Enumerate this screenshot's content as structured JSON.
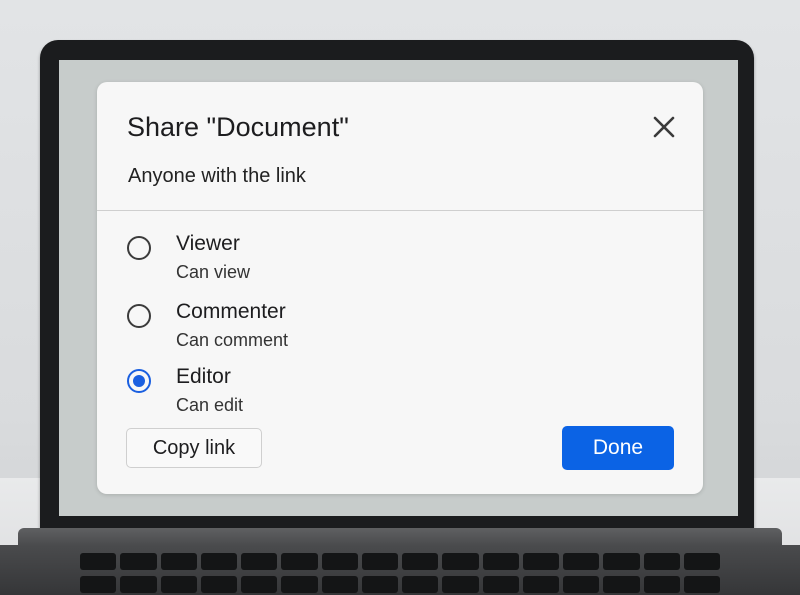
{
  "dialog": {
    "title": "Share \"Document\"",
    "subtitle": "Anyone with the link",
    "close_icon": "close-icon"
  },
  "options": [
    {
      "label": "Viewer",
      "description": "Can view",
      "selected": false
    },
    {
      "label": "Commenter",
      "description": "Can comment",
      "selected": false
    },
    {
      "label": "Editor",
      "description": "Can edit",
      "selected": true
    }
  ],
  "actions": {
    "copy_label": "Copy link",
    "done_label": "Done"
  },
  "colors": {
    "accent": "#0b63e5",
    "dialog_bg": "#f7f7f7",
    "screen_bg": "#c7cccb"
  }
}
